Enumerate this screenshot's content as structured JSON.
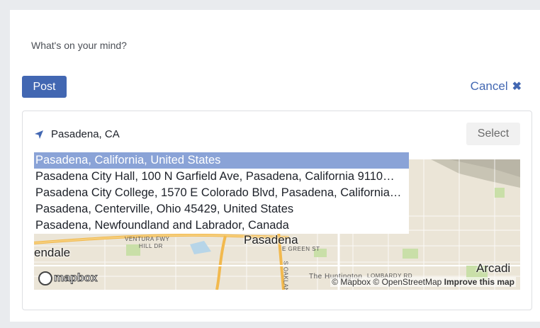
{
  "composer": {
    "prompt": "What's on your mind?",
    "post_label": "Post",
    "cancel_label": "Cancel"
  },
  "location": {
    "query": "Pasadena, CA",
    "select_label": "Select",
    "suggestions": [
      "Pasadena, California, United States",
      "Pasadena City Hall, 100 N Garfield Ave, Pasadena, California 9110…",
      "Pasadena City College, 1570 E Colorado Blvd, Pasadena, California…",
      "Pasadena, Centerville, Ohio 45429, United States",
      "Pasadena, Newfoundland and Labrador, Canada"
    ],
    "active_index": 0
  },
  "map": {
    "labels": {
      "city": "Pasadena",
      "glendale": "endale",
      "arcadia": "Arcadi",
      "ventura": "VENTURA FWY",
      "hill": "HILL DR",
      "green_st": "E GREEN ST",
      "oakland": "S OAKLAND",
      "huntington": "The Huntington",
      "lombardy": "LOMBARDY RD"
    },
    "logo": "mapbox",
    "attribution_prefix": "© Mapbox © OpenStreetMap",
    "improve_link": "Improve this map"
  },
  "colors": {
    "accent": "#4267b2",
    "highlight": "#8aa3d7"
  }
}
